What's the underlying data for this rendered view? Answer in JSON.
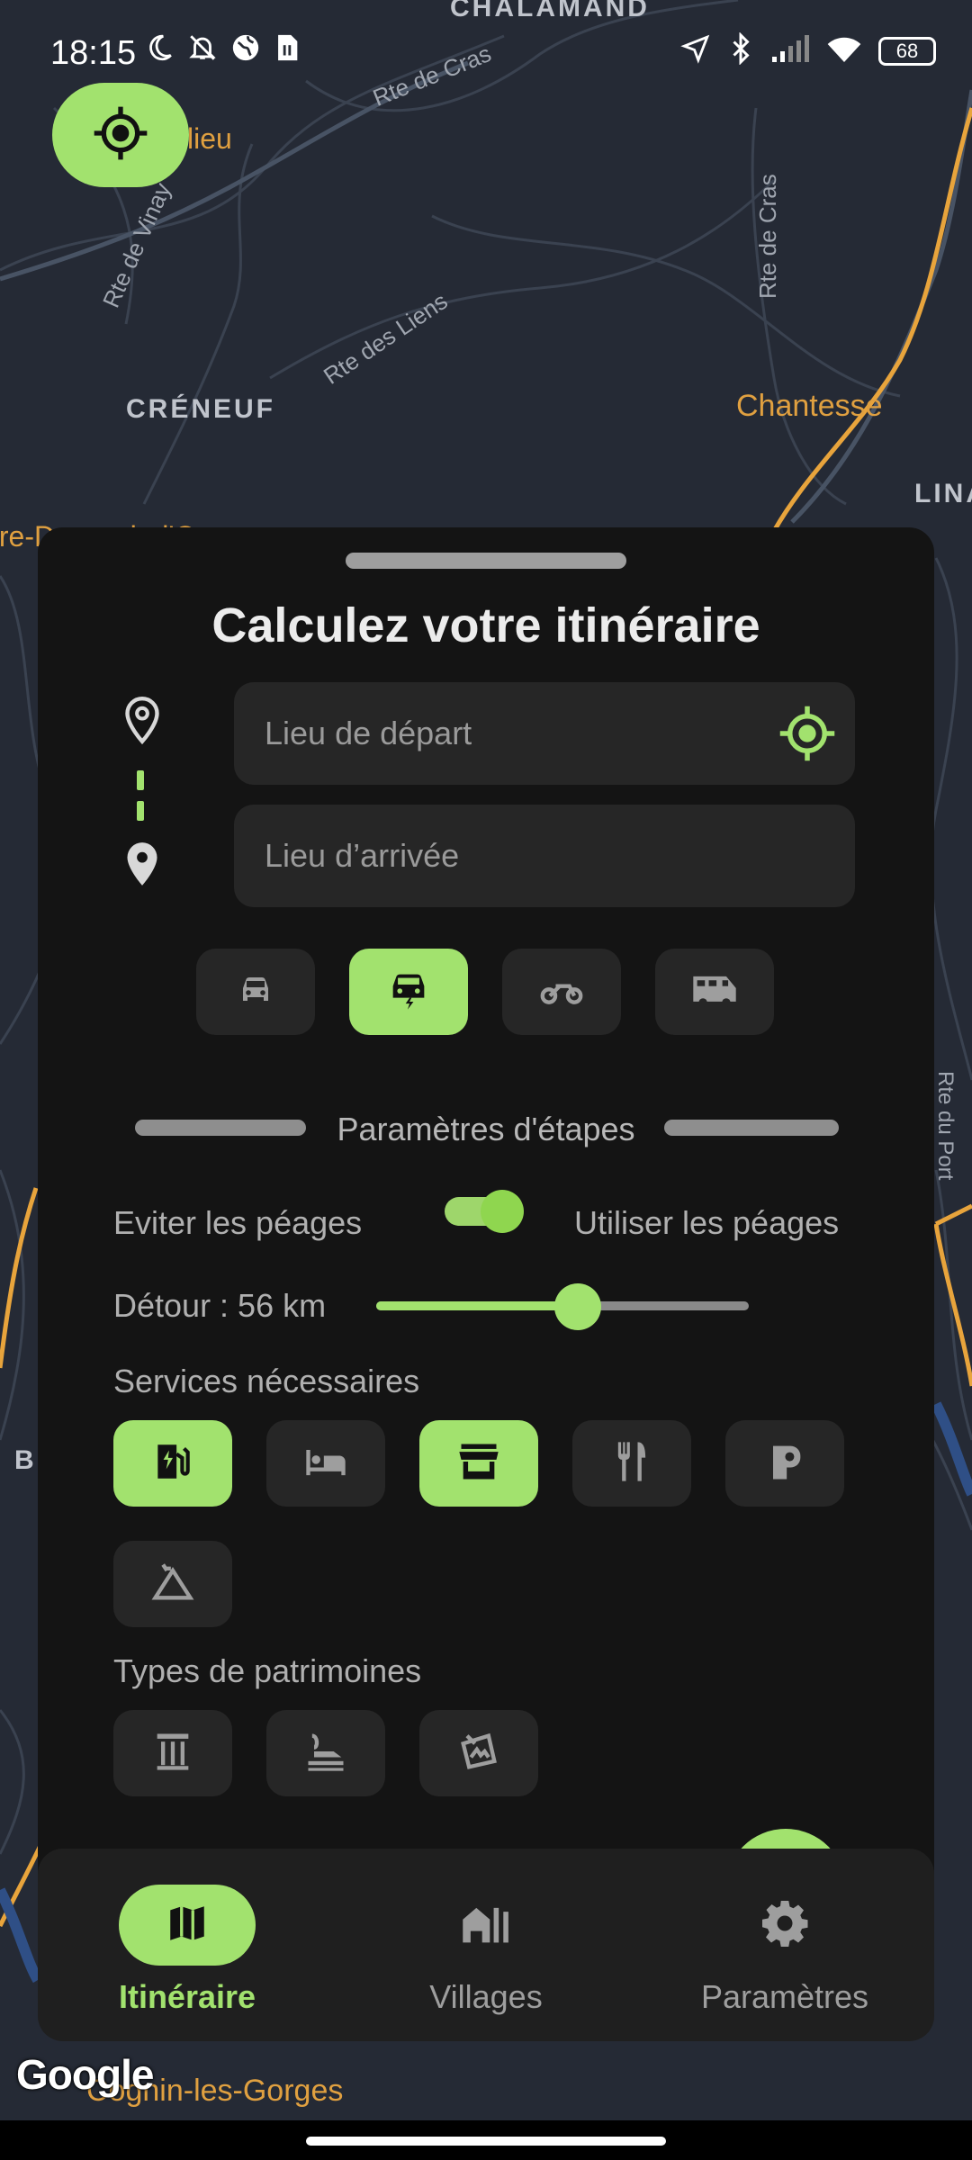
{
  "status_bar": {
    "time": "18:15",
    "battery": "68"
  },
  "map": {
    "labels": [
      "CHALAMAND",
      "lieu",
      "Rte de Cras",
      "Rte de Vinay",
      "Rte de Cras",
      "Rte des Liens",
      "CRÉNEUF",
      "Chantesse",
      "LINA",
      "tre-Dame-de-l'Os",
      "Rte du Port",
      "B"
    ],
    "bottom_label": "Cognin-les-Gorges",
    "attribution": "Google"
  },
  "route_sheet": {
    "title": "Calculez votre itinéraire",
    "start_placeholder": "Lieu de départ",
    "end_placeholder": "Lieu d’arrivée",
    "vehicles": [
      {
        "icon": "car-icon",
        "selected": false
      },
      {
        "icon": "electric-car-icon",
        "selected": true
      },
      {
        "icon": "motorcycle-icon",
        "selected": false
      },
      {
        "icon": "camper-van-icon",
        "selected": false
      }
    ],
    "section_title": "Paramètres d'étapes",
    "toll_left_label": "Eviter les péages",
    "toll_right_label": "Utiliser les péages",
    "toll_toggle_on": true,
    "detour_label": "Détour : 56 km",
    "detour_slider_fraction": 0.54,
    "services_label": "Services nécessaires",
    "services": [
      {
        "icon": "ev-charging-icon",
        "selected": true
      },
      {
        "icon": "hotel-bed-icon",
        "selected": false
      },
      {
        "icon": "store-icon",
        "selected": true
      },
      {
        "icon": "restaurant-icon",
        "selected": false
      },
      {
        "icon": "fuel-pump-icon",
        "selected": false
      },
      {
        "icon": "camping-tent-icon",
        "selected": false
      }
    ],
    "heritage_label": "Types de patrimoines",
    "heritage": [
      {
        "icon": "column-monument-icon",
        "selected": false
      },
      {
        "icon": "museum-pedestal-icon",
        "selected": false
      },
      {
        "icon": "artwork-frame-icon",
        "selected": false
      }
    ]
  },
  "bottom_nav": {
    "items": [
      {
        "label": "Itinéraire",
        "icon": "map-icon",
        "active": true
      },
      {
        "label": "Villages",
        "icon": "village-buildings-icon",
        "active": false
      },
      {
        "label": "Paramètres",
        "icon": "gear-icon",
        "active": false
      }
    ]
  },
  "colors": {
    "accent": "#a2e26e",
    "sheet_bg": "#141414",
    "surface": "#262626",
    "map_road_major": "#e8a43c",
    "map_label_orange": "#e0a040"
  }
}
